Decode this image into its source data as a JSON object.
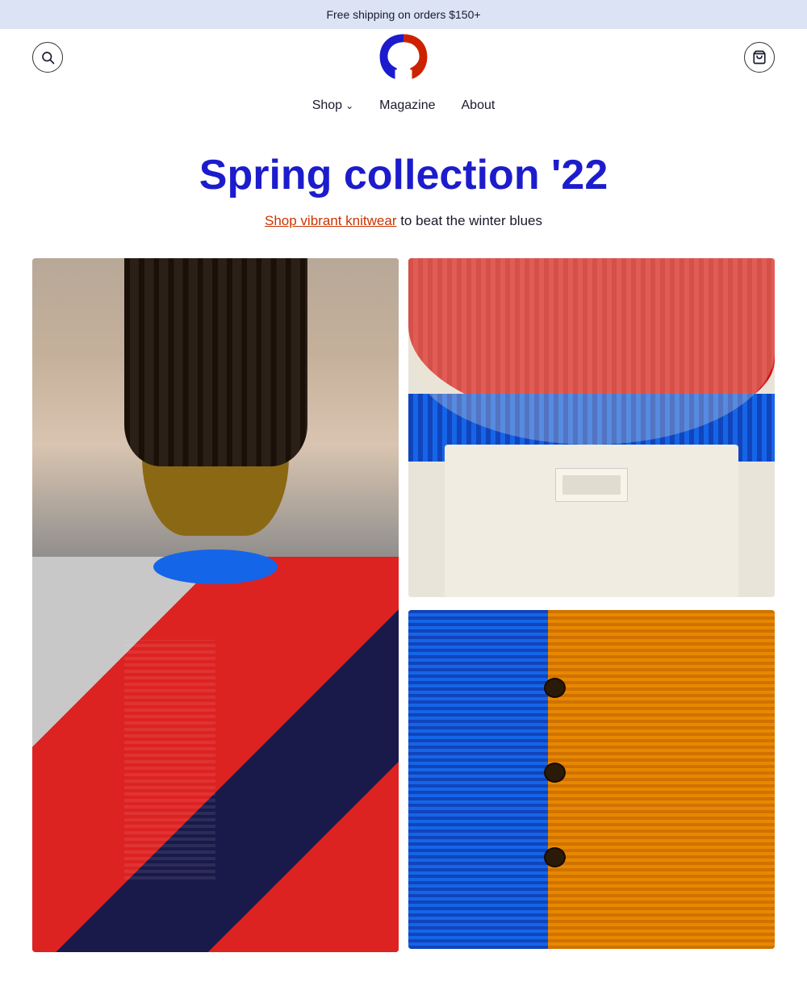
{
  "announcement": {
    "text": "Free shipping on orders $150+"
  },
  "header": {
    "search_label": "Search",
    "cart_label": "Cart",
    "logo_alt": "Brand logo"
  },
  "nav": {
    "items": [
      {
        "label": "Shop",
        "has_dropdown": true
      },
      {
        "label": "Magazine",
        "has_dropdown": false
      },
      {
        "label": "About",
        "has_dropdown": false
      }
    ]
  },
  "hero": {
    "title": "Spring collection '22",
    "subtitle_link": "Shop vibrant knitwear",
    "subtitle_text": " to beat the winter blues"
  },
  "images": {
    "left_alt": "Model wearing colorblock knitwear sweater",
    "right_top_alt": "Close-up of red and blue knit collar detail",
    "right_bottom_alt": "Blue and orange colorblock cardigan close-up"
  },
  "colors": {
    "announcement_bg": "#dce3f5",
    "hero_title": "#1c1ccc",
    "link_color": "#cc3300",
    "body_text": "#1a1a2e"
  }
}
